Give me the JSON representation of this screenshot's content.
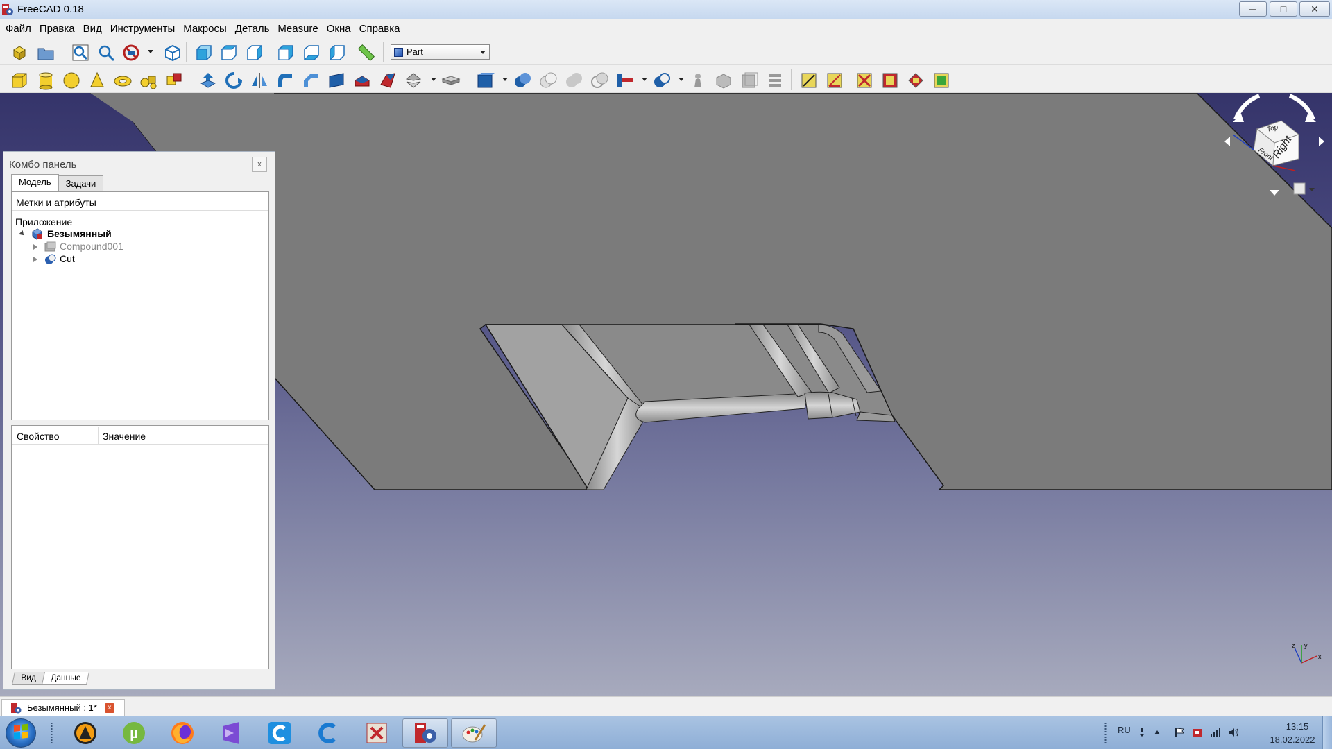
{
  "window": {
    "title": "FreeCAD 0.18",
    "minimize_icon": "minimize-icon",
    "maximize_icon": "maximize-icon",
    "close_icon": "close-icon"
  },
  "menu": [
    "Файл",
    "Правка",
    "Вид",
    "Инструменты",
    "Макросы",
    "Деталь",
    "Measure",
    "Окна",
    "Справка"
  ],
  "toolbar": {
    "workbench_selected": "Part"
  },
  "combo_panel": {
    "title": "Комбо панель",
    "close_label": "x",
    "tabs": [
      "Модель",
      "Задачи"
    ],
    "active_tab": "Модель",
    "tree": {
      "header_labels": "Метки и атрибуты",
      "root_label": "Приложение",
      "document": "Безымянный",
      "items": [
        {
          "label": "Compound001",
          "icon": "compound-icon",
          "hidden": true
        },
        {
          "label": "Cut",
          "icon": "cut-icon",
          "hidden": false
        }
      ]
    },
    "properties": {
      "col_property": "Свойство",
      "col_value": "Значение"
    },
    "bottom_tabs": [
      "Вид",
      "Данные"
    ],
    "active_bottom_tab": "Данные"
  },
  "navcube": {
    "top": "Top",
    "front": "Front",
    "right": "Right"
  },
  "axis": {
    "x": "x",
    "y": "y",
    "z": "z"
  },
  "document_tab": {
    "label": "Безымянный : 1*",
    "close_label": "x"
  },
  "taskbar": {
    "apps": [
      "aimp-icon",
      "utorrent-icon",
      "firefox-icon",
      "visual-studio-icon",
      "ccleaner-icon",
      "chrome-c-icon",
      "pdf-editor-icon",
      "freecad-icon",
      "paint-icon"
    ],
    "active_app": "freecad-icon",
    "language": "RU",
    "time": "13:15",
    "date": "18.02.2022"
  },
  "colors": {
    "viewport_top": "#35346a",
    "viewport_bottom": "#a7aabd",
    "model_face": "#7b7b7b",
    "model_side": "#a0a0a0"
  }
}
